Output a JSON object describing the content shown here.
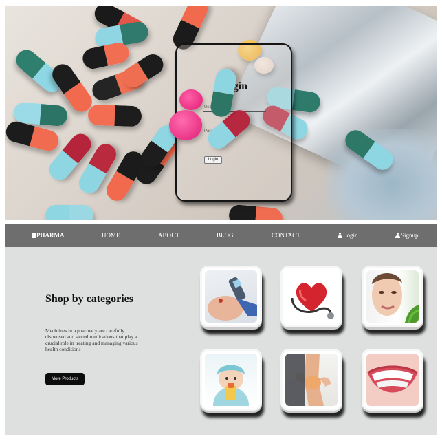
{
  "login": {
    "title": "Login",
    "user_placeholder": "User Id",
    "password_placeholder": "Password",
    "button_label": "Login"
  },
  "navbar": {
    "brand": "PHARMA",
    "items": [
      "HOME",
      "ABOUT",
      "BLOG",
      "CONTACT"
    ],
    "login_label": "Login",
    "signup_label": "Signup"
  },
  "categories": {
    "heading": "Shop by categories",
    "description": "Medicines in a pharmacy are carefully dispensed and stored medications that play a crucial role in treating and managing various health conditions",
    "button_label": "More Products",
    "tiles": [
      "glucose-test",
      "heart-stethoscope",
      "skin-care",
      "baby-care",
      "joint-pain",
      "dental-care"
    ]
  },
  "colors": {
    "navbar_bg": "#6e6e6e",
    "section_bg": "#dde0df",
    "button_bg": "#0c0c0c"
  }
}
